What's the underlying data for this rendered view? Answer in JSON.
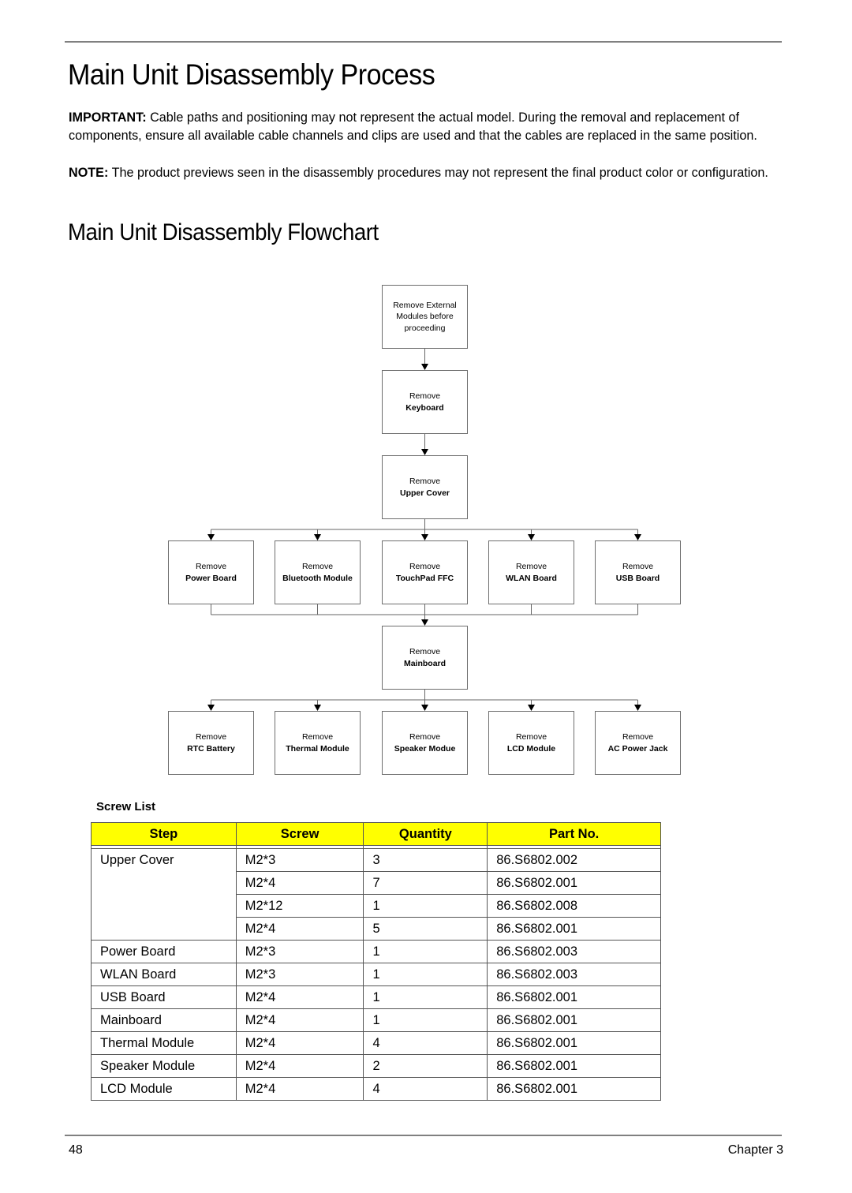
{
  "page": {
    "title": "Main Unit Disassembly Process",
    "important_label": "IMPORTANT:",
    "important_text": " Cable paths and positioning may not represent the actual model. During the removal and replacement of components, ensure all available cable channels and clips are used and that the cables are replaced in the same position.",
    "note_label": "NOTE:",
    "note_text": " The product previews seen in the disassembly procedures may not represent the final product color or configuration.",
    "flowchart_heading": "Main Unit Disassembly Flowchart"
  },
  "flowchart": {
    "start": {
      "text": "Remove External Modules before proceeding"
    },
    "sequence": [
      {
        "verb": "Remove",
        "object": "Keyboard"
      },
      {
        "verb": "Remove",
        "object": "Upper Cover"
      }
    ],
    "level1": [
      {
        "verb": "Remove",
        "object": "Power Board"
      },
      {
        "verb": "Remove",
        "object": "Bluetooth Module"
      },
      {
        "verb": "Remove",
        "object": "TouchPad FFC"
      },
      {
        "verb": "Remove",
        "object": "WLAN Board"
      },
      {
        "verb": "Remove",
        "object": "USB Board"
      }
    ],
    "merge": {
      "verb": "Remove",
      "object": "Mainboard"
    },
    "level2": [
      {
        "verb": "Remove",
        "object": "RTC Battery"
      },
      {
        "verb": "Remove",
        "object": "Thermal Module"
      },
      {
        "verb": "Remove",
        "object": "Speaker Modue"
      },
      {
        "verb": "Remove",
        "object": "LCD Module"
      },
      {
        "verb": "Remove",
        "object": "AC Power Jack"
      }
    ]
  },
  "screw_list": {
    "title": "Screw List",
    "header_color": "#ffff00",
    "columns": [
      "Step",
      "Screw",
      "Quantity",
      "Part No."
    ],
    "rows": [
      {
        "step": "Upper Cover",
        "screw": "M2*3",
        "quantity": "3",
        "part_no": "86.S6802.002"
      },
      {
        "step": "",
        "screw": "M2*4",
        "quantity": "7",
        "part_no": "86.S6802.001"
      },
      {
        "step": "",
        "screw": "M2*12",
        "quantity": "1",
        "part_no": "86.S6802.008"
      },
      {
        "step": "",
        "screw": "M2*4",
        "quantity": "5",
        "part_no": "86.S6802.001"
      },
      {
        "step": "Power Board",
        "screw": "M2*3",
        "quantity": "1",
        "part_no": "86.S6802.003"
      },
      {
        "step": "WLAN Board",
        "screw": "M2*3",
        "quantity": "1",
        "part_no": "86.S6802.003"
      },
      {
        "step": "USB Board",
        "screw": "M2*4",
        "quantity": "1",
        "part_no": "86.S6802.001"
      },
      {
        "step": "Mainboard",
        "screw": "M2*4",
        "quantity": "1",
        "part_no": "86.S6802.001"
      },
      {
        "step": "Thermal Module",
        "screw": "M2*4",
        "quantity": "4",
        "part_no": "86.S6802.001"
      },
      {
        "step": "Speaker Module",
        "screw": "M2*4",
        "quantity": "2",
        "part_no": "86.S6802.001"
      },
      {
        "step": "LCD Module",
        "screw": "M2*4",
        "quantity": "4",
        "part_no": "86.S6802.001"
      }
    ]
  },
  "footer": {
    "page_number": "48",
    "chapter": "Chapter 3"
  }
}
